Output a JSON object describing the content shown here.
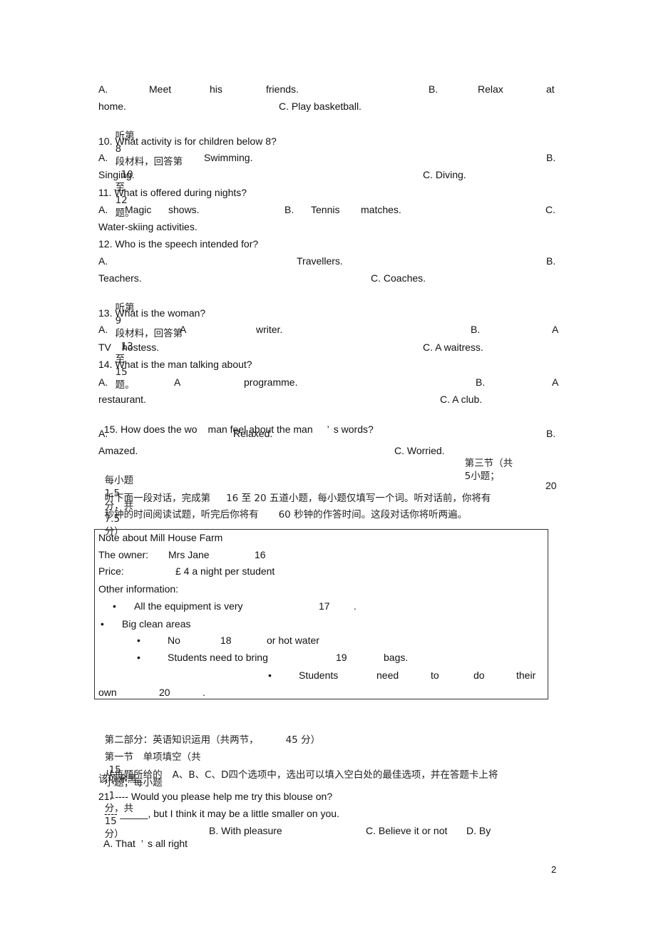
{
  "q9_options": {
    "a_label": "A.",
    "a_words": [
      "Meet",
      "his",
      "friends."
    ],
    "b_label": "B.",
    "b_words": [
      "Relax",
      "at"
    ],
    "b_cont": "home.",
    "c": "C. Play basketball."
  },
  "section8_intro": {
    "p1": "听第",
    "num": "8",
    "p2": "段材料，回答第",
    "from": "10",
    "to_word": "至",
    "to": "12",
    "end": "题。"
  },
  "q10": {
    "stem": "10. What activity is for children below 8?",
    "a_label": "A.",
    "a_text": "Swimming.",
    "b_label": "B.",
    "b_text": "Singing.",
    "c": "C. Diving."
  },
  "q11": {
    "stem": "11. What is offered during nights?",
    "a_label": "A.",
    "a_words": [
      "Magic",
      "shows."
    ],
    "b_label": "B.",
    "b_words": [
      "Tennis",
      "matches."
    ],
    "c_label": "C.",
    "c_text": "Water-skiing activities."
  },
  "q12": {
    "stem": "12. Who is the speech intended for?",
    "a_label": "A.",
    "a_text": "Travellers.",
    "b_label": "B.",
    "b_text": "Teachers.",
    "c": "C. Coaches."
  },
  "section9_intro": {
    "p1": "听第",
    "num": "9",
    "p2": "段材料，回答第",
    "from": "13",
    "to_word": "至",
    "to": "15",
    "end": "题。"
  },
  "q13": {
    "stem": "13. What is the woman?",
    "a_label": "A.",
    "a_words": [
      "A",
      "writer."
    ],
    "b_label": "B.",
    "b_word": "A",
    "b_cont": [
      "TV",
      "hostess."
    ],
    "c": "C. A waitress."
  },
  "q14": {
    "stem": "14. What is the man talking about?",
    "a_label": "A.",
    "a_words": [
      "A",
      "programme."
    ],
    "b_label": "B.",
    "b_word": "A",
    "b_cont": "restaurant.",
    "c": "C. A club."
  },
  "q15": {
    "stem_p1": "15. How does the wo",
    "stem_p2": "man feel about the man",
    "stem_p3": "’",
    "stem_p4": "s words?",
    "a_label": "A.",
    "a_text": "Relaxed.",
    "b_label": "B.",
    "b_text": "Amazed.",
    "c": "C. Worried."
  },
  "section3": {
    "title_p1": "第三节（共",
    "count": "5",
    "title_p2": "小题；",
    "line2_p1": "每小题",
    "each": "1.5",
    "line2_p2": "分，共",
    "total": "7.5",
    "line2_p3": "分）",
    "instr1_p1": "听下面一段对话，完成第",
    "from": "16",
    "to_word": "至",
    "to": "20",
    "instr1_p2": "五道小题，每小题仅填写一个词。听对话前，你将有",
    "read_secs": "20",
    "instr2_p1": "秒钟的时间阅读试题，听完后你将有",
    "answer_secs": "60",
    "instr2_p2": "秒钟的作答时间。这段对话你将听两遍。"
  },
  "note": {
    "title": "Note about Mill House Farm",
    "owner_label": "The owner:",
    "owner_value": "Mrs Jane",
    "owner_blank": "16",
    "price_label": "Price:",
    "price_value": "£ 4 a night per student",
    "other_label": "Other information:",
    "bullet": "•",
    "item1_text": "All the equipment is very",
    "item1_blank": "17",
    "item1_end": ".",
    "item2_text": "Big clean areas",
    "item3_p1": "No",
    "item3_blank": "18",
    "item3_p2": "or hot water",
    "item4_p1": "Students need to bring",
    "item4_blank": "19",
    "item4_p2": "bags.",
    "item5_words": [
      "Students",
      "need",
      "to",
      "do",
      "their"
    ],
    "item5_cont": "own",
    "item5_blank": "20",
    "item5_end": "."
  },
  "part2": {
    "title_p1": "第二部分：英语知识运用（共两节，",
    "score": "45",
    "title_p2": "分）",
    "sec1_p1": "第一节　单项填空（共",
    "count": "15",
    "sec1_p2": "小题；每小题",
    "each": "1",
    "sec1_p3": "分，共",
    "total": "15",
    "sec1_p4": "分）",
    "instr_p1": "从每题所给的",
    "instr_opts": "A、B、C、D",
    "instr_p2": "四个选项中，选出可以填入空白处的最佳选项，并在答题卡上将",
    "instr_line2": "该项涂黑。"
  },
  "q21": {
    "stem": "21. ---- Would you please help me try this blouse on?",
    "reply": "---- _____, but I think it may be a little smaller on you.",
    "a_p1": "A. That",
    "a_apos": "’",
    "a_p2": "s all right",
    "b": "B. With pleasure",
    "c": "C. Believe it or not",
    "d": "D. By"
  },
  "page_number": "2"
}
